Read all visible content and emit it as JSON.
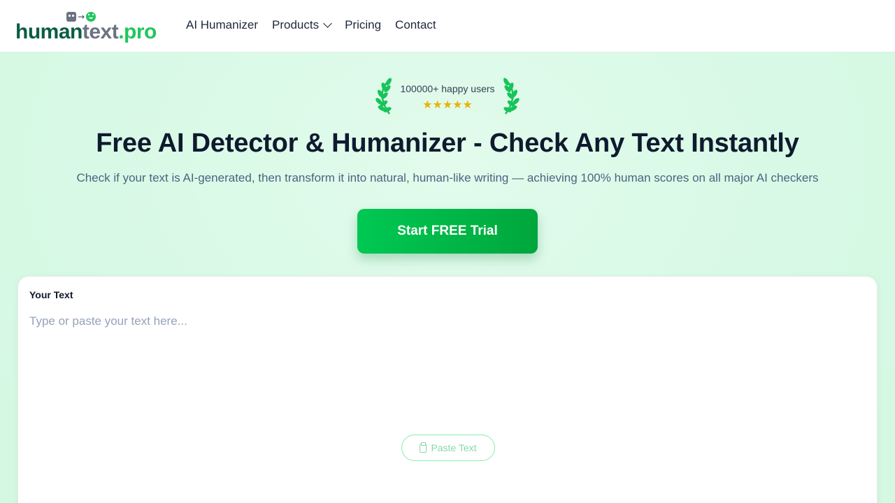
{
  "header": {
    "logo": {
      "part1": "human",
      "part2": "text",
      "part3": ".pro",
      "icons": [
        "robot-icon",
        "arrow-right-icon",
        "smiley-icon"
      ]
    },
    "nav": [
      {
        "label": "AI Humanizer"
      },
      {
        "label": "Products",
        "has_dropdown": true
      },
      {
        "label": "Pricing"
      },
      {
        "label": "Contact"
      }
    ]
  },
  "hero": {
    "badge_text": "100000+ happy users",
    "rating_stars": 5,
    "stars_text": "★★★★★",
    "title": "Free AI Detector & Humanizer - Check Any Text Instantly",
    "subtitle": "Check if your text is AI-generated, then transform it into natural, human-like writing — achieving 100% human scores on all major AI checkers",
    "cta_label": "Start FREE Trial"
  },
  "editor": {
    "label": "Your Text",
    "placeholder": "Type or paste your text here...",
    "value": "",
    "paste_label": "Paste Text"
  },
  "colors": {
    "brand_green": "#22c55e",
    "brand_dark_green": "#0c5c45",
    "cta_start": "#00c853",
    "cta_end": "#00a63c",
    "hero_bg": "#d9f9e6",
    "star": "#eab308"
  }
}
